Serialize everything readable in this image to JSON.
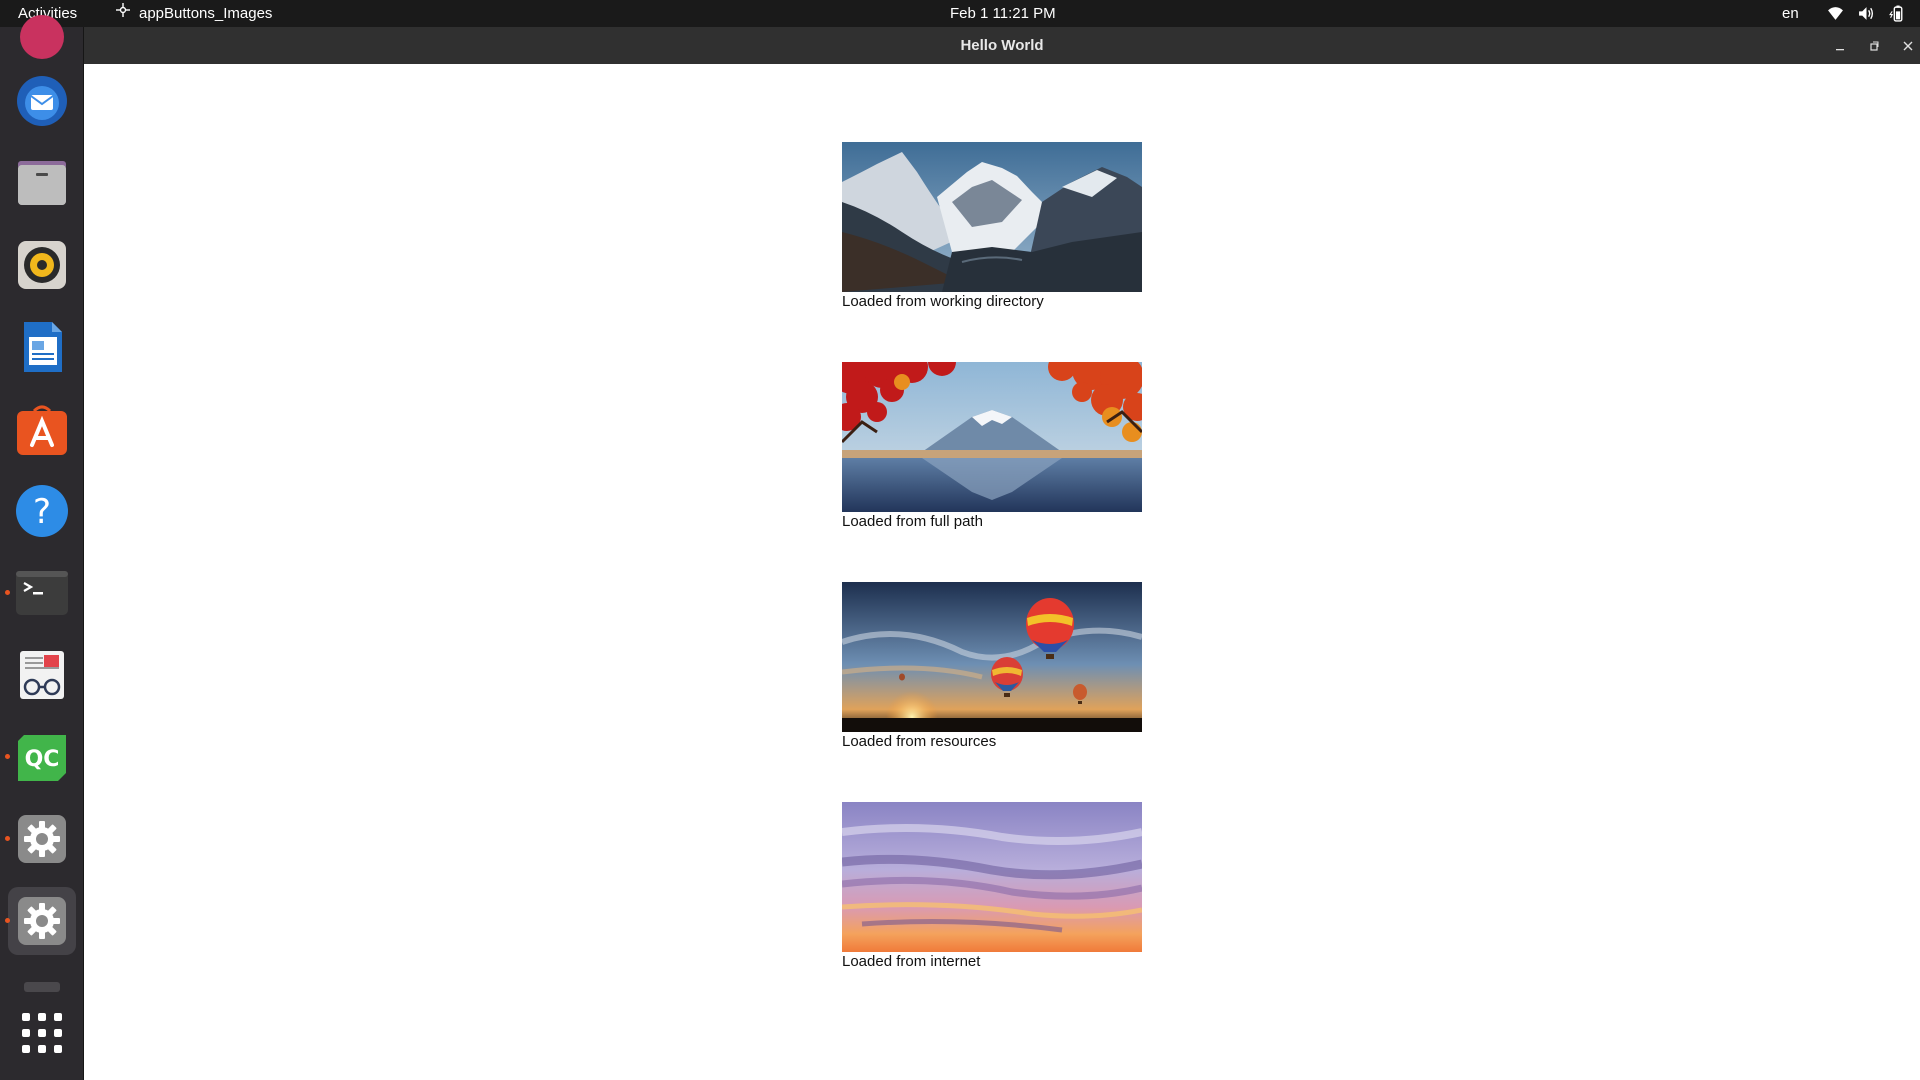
{
  "topbar": {
    "activities": "Activities",
    "app_name": "appButtons_Images",
    "datetime": "Feb 1  11:21 PM",
    "language": "en",
    "tray_icons": [
      "wifi-icon",
      "volume-icon",
      "battery-icon"
    ]
  },
  "dock": {
    "items": [
      {
        "name": "thunderbird",
        "icon": "thunderbird-icon",
        "running": false
      },
      {
        "name": "files",
        "icon": "files-icon",
        "running": false
      },
      {
        "name": "rhythmbox",
        "icon": "rhythmbox-icon",
        "running": false
      },
      {
        "name": "libreoffice-writer",
        "icon": "writer-icon",
        "running": false
      },
      {
        "name": "app-center",
        "icon": "app-center-icon",
        "running": false
      },
      {
        "name": "help",
        "icon": "help-icon",
        "running": false
      },
      {
        "name": "terminal",
        "icon": "terminal-icon",
        "running": true
      },
      {
        "name": "document-viewer",
        "icon": "document-viewer-icon",
        "running": false
      },
      {
        "name": "qt-creator",
        "icon": "qt-creator-icon",
        "running": true
      },
      {
        "name": "settings",
        "icon": "gear-icon",
        "running": true
      },
      {
        "name": "settings-active",
        "icon": "gear-icon",
        "running": true
      }
    ],
    "show_apps_icon": "grid-icon",
    "qt_creator_label": "QC",
    "accent_color": "#e95420"
  },
  "window": {
    "title": "Hello World",
    "controls": [
      "minimize-icon",
      "maximize-icon",
      "close-icon"
    ]
  },
  "content": {
    "images": [
      {
        "scene": "snowy-mountain-valley",
        "caption": "Loaded from working directory"
      },
      {
        "scene": "red-maple-mount-fuji-lake",
        "caption": "Loaded from full path"
      },
      {
        "scene": "hot-air-balloons-sunset",
        "caption": "Loaded from resources"
      },
      {
        "scene": "purple-sunset-sky",
        "caption": "Loaded from internet"
      }
    ]
  }
}
